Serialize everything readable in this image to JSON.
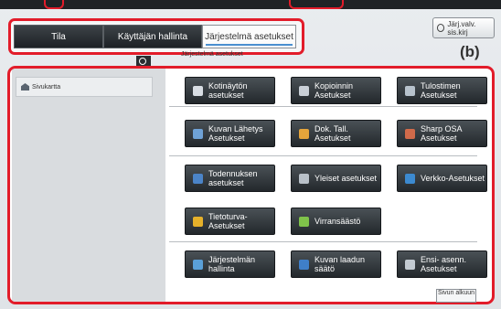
{
  "tabs": [
    "Tila",
    "Käyttäjän hallinta",
    "Järjestelmä asetukset"
  ],
  "manual_button": "Järj.valv. sis.kirj",
  "callout_b": "(b)",
  "breadcrumb": "Järjestelmä asetukset",
  "sidebar": {
    "sitemap_label": "Sivukartta"
  },
  "buttons": [
    {
      "label": "Kotinäytön asetukset",
      "icon": "home-icon",
      "color": "#d8dde3"
    },
    {
      "label": "Kopioinnin Asetukset",
      "icon": "copier-icon",
      "color": "#c9cfd6"
    },
    {
      "label": "Tulostimen Asetukset",
      "icon": "printer-icon",
      "color": "#b7c2cc"
    },
    {
      "label": "Kuvan Lähetys Asetukset",
      "icon": "send-icon",
      "color": "#6fa2d6"
    },
    {
      "label": "Dok. Tall. Asetukset",
      "icon": "folder-icon",
      "color": "#e5a53b"
    },
    {
      "label": "Sharp OSA Asetukset",
      "icon": "osa-icon",
      "color": "#d06a4a"
    },
    {
      "label": "Todennuksen asetukset",
      "icon": "user-auth-icon",
      "color": "#4b84c8"
    },
    {
      "label": "Yleiset asetukset",
      "icon": "tools-icon",
      "color": "#b9c1c9"
    },
    {
      "label": "Verkko-Asetukset",
      "icon": "globe-icon",
      "color": "#3c8ad0"
    },
    {
      "label": "Tietoturva-Asetukset",
      "icon": "lock-icon",
      "color": "#e6b12a"
    },
    {
      "label": "Virransäästö",
      "icon": "leaf-icon",
      "color": "#7fc24a"
    },
    {
      "label": "Järjestelmän hallinta",
      "icon": "monitor-icon",
      "color": "#5aa0d8"
    },
    {
      "label": "Kuvan laadun säätö",
      "icon": "image-quality-icon",
      "color": "#3f7fc9"
    },
    {
      "label": "Ensi- asenn. Asetukset",
      "icon": "setup-icon",
      "color": "#c3cbd2"
    }
  ],
  "page_top_label": "Sivun alkuun"
}
